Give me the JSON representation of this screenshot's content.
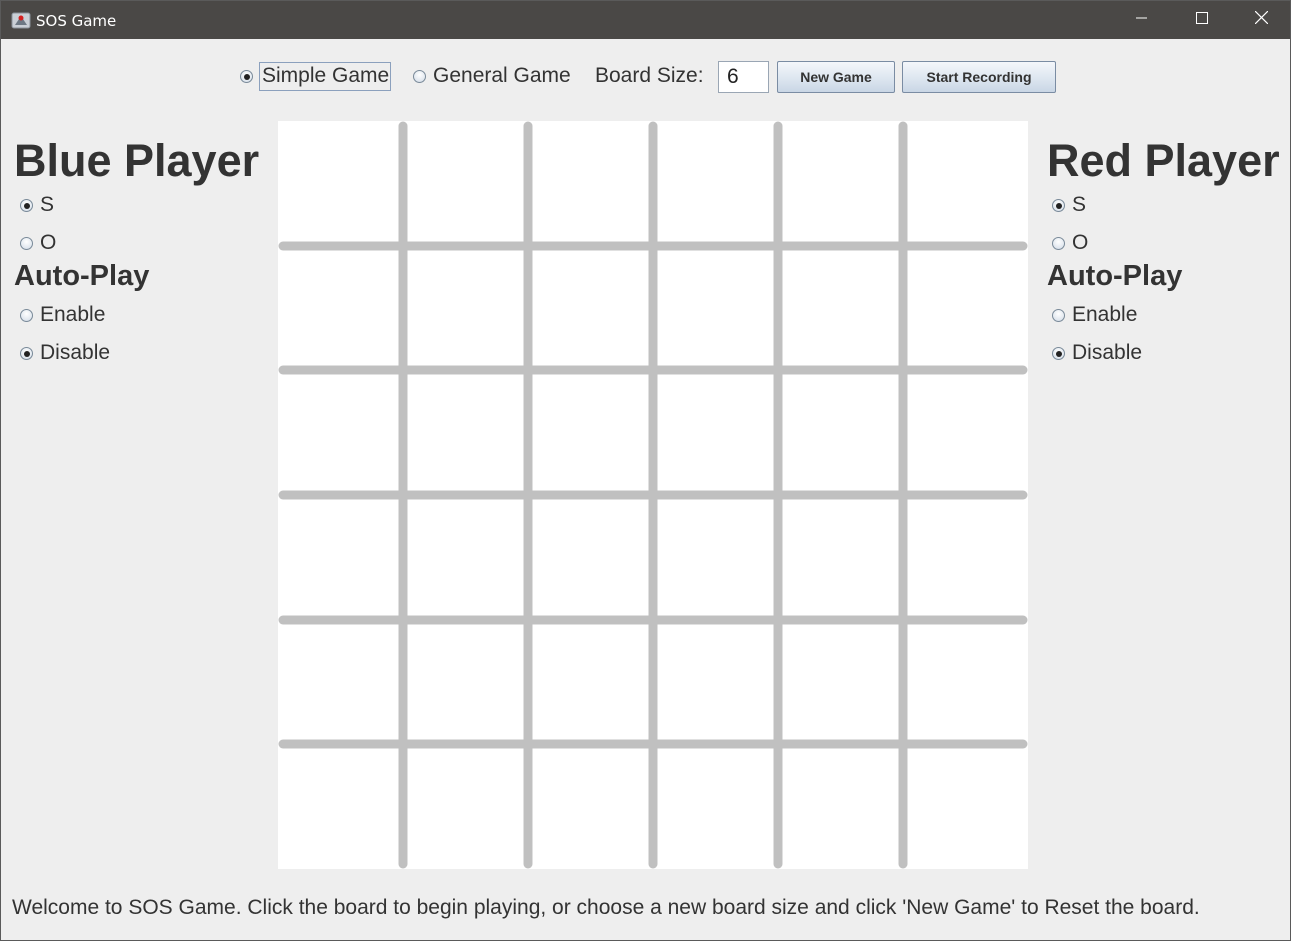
{
  "window": {
    "title": "SOS Game",
    "app_icon": "java-app-icon",
    "controls": [
      "minimize-icon",
      "maximize-icon",
      "close-icon"
    ]
  },
  "toolbar": {
    "game_modes": [
      {
        "label": "Simple Game",
        "selected": true
      },
      {
        "label": "General Game",
        "selected": false
      }
    ],
    "board_size_label": "Board Size:",
    "board_size_value": "6",
    "new_game_label": "New Game",
    "start_recording_label": "Start Recording"
  },
  "blue_player": {
    "title": "Blue Player",
    "letters": [
      {
        "label": "S",
        "selected": true
      },
      {
        "label": "O",
        "selected": false
      }
    ],
    "autoplay_title": "Auto-Play",
    "autoplay": [
      {
        "label": "Enable",
        "selected": false
      },
      {
        "label": "Disable",
        "selected": true
      }
    ]
  },
  "red_player": {
    "title": "Red Player",
    "letters": [
      {
        "label": "S",
        "selected": true
      },
      {
        "label": "O",
        "selected": false
      }
    ],
    "autoplay_title": "Auto-Play",
    "autoplay": [
      {
        "label": "Enable",
        "selected": false
      },
      {
        "label": "Disable",
        "selected": true
      }
    ]
  },
  "board": {
    "size": 6,
    "cells": [
      [
        "",
        "",
        "",
        "",
        "",
        ""
      ],
      [
        "",
        "",
        "",
        "",
        "",
        ""
      ],
      [
        "",
        "",
        "",
        "",
        "",
        ""
      ],
      [
        "",
        "",
        "",
        "",
        "",
        ""
      ],
      [
        "",
        "",
        "",
        "",
        "",
        ""
      ],
      [
        "",
        "",
        "",
        "",
        "",
        ""
      ]
    ],
    "line_color": "#c0c0c0",
    "background": "#ffffff"
  },
  "status": {
    "message": "Welcome to SOS Game. Click the board to begin playing, or choose a new board size and click 'New Game' to Reset the board."
  }
}
